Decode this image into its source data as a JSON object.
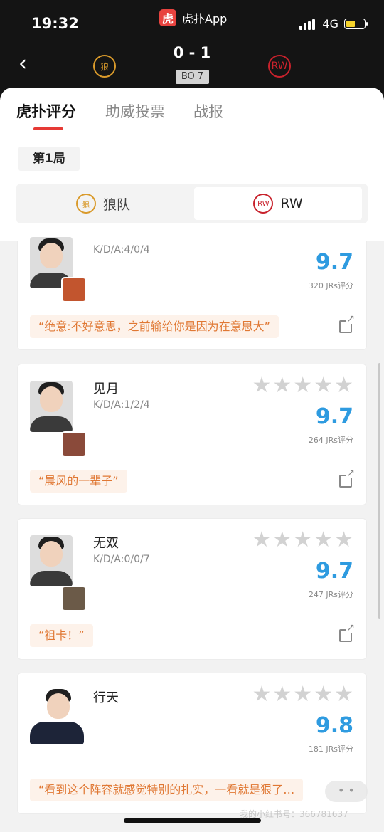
{
  "status_bar": {
    "time": "19:32",
    "network": "4G"
  },
  "app": {
    "logo_char": "虎",
    "name": "虎扑App"
  },
  "match": {
    "score": "0 - 1",
    "format": "BO 7",
    "team_left_logo": "狼",
    "team_right_logo": "RW"
  },
  "tabs": [
    {
      "label": "虎扑评分"
    },
    {
      "label": "助威投票"
    },
    {
      "label": "战报"
    }
  ],
  "game_label": "第1局",
  "team_switch": [
    {
      "name": "狼队",
      "logo": "狼"
    },
    {
      "name": "RW",
      "logo": "RW"
    }
  ],
  "players": [
    {
      "name": "",
      "kda": "K/D/A:4/0/4",
      "score": "9.7",
      "votes": "320 JRs评分",
      "comment": "“绝意:不好意思，之前输给你是因为在意思大”"
    },
    {
      "name": "见月",
      "kda": "K/D/A:1/2/4",
      "score": "9.7",
      "votes": "264 JRs评分",
      "comment": "“晨风的一辈子”"
    },
    {
      "name": "无双",
      "kda": "K/D/A:0/0/7",
      "score": "9.7",
      "votes": "247 JRs评分",
      "comment": "“祖卡！”"
    },
    {
      "name": "行天",
      "kda": "",
      "score": "9.8",
      "votes": "181 JRs评分",
      "comment": "“看到这个阵容就感觉特别的扎实，一看就是狠了…"
    }
  ],
  "icons": {
    "star": "★",
    "back": "‹"
  },
  "float_button": "• •",
  "watermark": "我的小红书号：366781637"
}
